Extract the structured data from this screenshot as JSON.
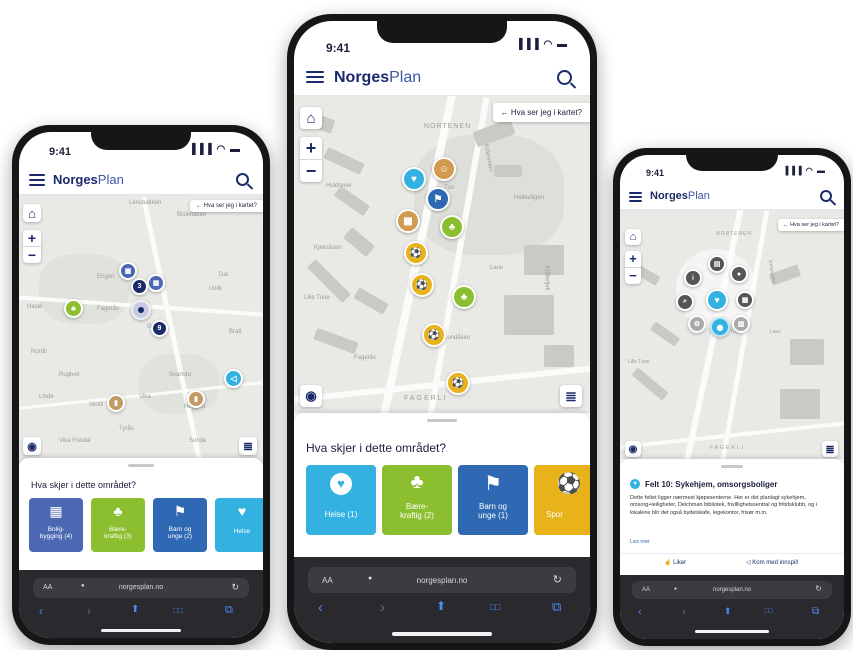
{
  "status": {
    "time": "9:41",
    "signal": "▐▐▐ ◠ ▬"
  },
  "brand": {
    "bold": "Norges",
    "light": "Plan"
  },
  "map": {
    "hva_label": "Hva ser jeg i kartet?",
    "zoom_in": "+",
    "zoom_out": "−",
    "home_glyph": "⌂",
    "back_arrow": "←",
    "locate_glyph": "◉",
    "filter_glyph": "≣"
  },
  "sheet": {
    "title": "Hva skjer i dette området?"
  },
  "browser": {
    "aa": "AA",
    "lock": "🔒",
    "url": "norgesplan.no",
    "reload": "↻",
    "back": "‹",
    "forward": "›",
    "share": "⬆",
    "book": "□□",
    "tabs": "⧉"
  },
  "phone_left": {
    "map_labels": [
      "Lensbakken",
      "Bislettåsen",
      "Hasle",
      "Engen",
      "Ulvik",
      "Grini",
      "Fagerås",
      "Bratt",
      "Nordli",
      "Rugtvet",
      "Svartstu",
      "Dal",
      "Heggen",
      "Linde",
      "Vestli",
      "Vika",
      "Tyrås",
      "Vika Freidal",
      "Sunde"
    ],
    "clusters": [
      "3",
      "9"
    ],
    "categories": [
      {
        "label": "Bolig-\nbygging",
        "count": "(4)",
        "color": "#4c67b3",
        "icon": "▦"
      },
      {
        "label": "Bære-\nkraftig",
        "count": "(3)",
        "color": "#8cbf2f",
        "icon": "♣"
      },
      {
        "label": "Barn og\nunge",
        "count": "(2)",
        "color": "#2f69b3",
        "icon": "⚑"
      },
      {
        "label": "Helse",
        "count": "",
        "color": "#33b1e0",
        "icon": "♥"
      }
    ]
  },
  "phone_middle": {
    "map_labels": [
      "NORTENEN",
      "FAGERLI",
      "Kirkeveien",
      "Huldrevei",
      "Tun",
      "Kjeksåsen",
      "Hellevågen",
      "Kråkefjell",
      "Lille Tune",
      "Lauv",
      "Fagerås",
      "Lundåsen"
    ],
    "categories": [
      {
        "label": "Helse",
        "count": "(1)",
        "color": "#33b1e0",
        "icon": "♥"
      },
      {
        "label": "Bære-\nkraftig",
        "count": "(2)",
        "color": "#8cbf2f",
        "icon": "♣"
      },
      {
        "label": "Barn og\nunge",
        "count": "(1)",
        "color": "#2f69b3",
        "icon": "⚑"
      },
      {
        "label": "Spor",
        "count": "",
        "color": "#e8b21a",
        "icon": "⚽"
      }
    ]
  },
  "phone_right": {
    "map_labels": [
      "NORTENEN",
      "FAGERLI",
      "Kirkeveien",
      "Tun",
      "Lille Tune",
      "Lauv"
    ],
    "hub_icons": [
      "i",
      "▤",
      "●",
      "⌕",
      "♥",
      "▦",
      "⚙",
      "◉",
      "▧"
    ],
    "detail": {
      "title": "Felt 10: Sykehjem, omsorgsboliger",
      "body": "Dette feltet ligger nærmest kjøpesenterne. Her er det planlagt sykehjem, omsorg+leiligheter, Deichman bibliotek, frivillighetssentral og fritidsklubb, og i lokalene blir det også bydelskafe, legekontor, frisør m.m.",
      "more": "Les mer",
      "like": "Liker",
      "comment": "Kom med innspill"
    }
  }
}
